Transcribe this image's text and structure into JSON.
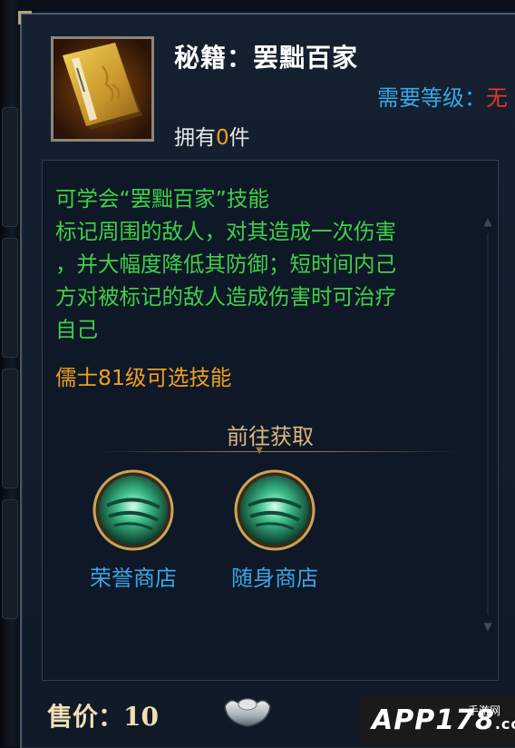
{
  "item": {
    "title": "秘籍：罢黜百家",
    "level_label": "需要等级：",
    "level_value": "无",
    "owned_prefix": "拥有",
    "owned_count": "0",
    "owned_suffix": "件"
  },
  "description": {
    "lines": [
      "可学会“罢黜百家”技能",
      "标记周围的敌人，对其造成一次伤害",
      "，并大幅度降低其防御；短时间内己",
      "方对被标记的敌人造成伤害时可治疗",
      "自己"
    ],
    "class_note": "儒士81级可选技能"
  },
  "goto": {
    "title": "前往获取",
    "shops": [
      {
        "label": "荣誉商店",
        "icon": "green-vortex-icon"
      },
      {
        "label": "随身商店",
        "icon": "green-vortex-icon"
      }
    ]
  },
  "price": {
    "label": "售价：",
    "value": "10",
    "currency_icon": "silver-ingot-icon"
  },
  "watermark": {
    "text": "APP178",
    "sub": "手游网",
    "domain": ".com"
  },
  "colors": {
    "title": "#ffffff",
    "level_label": "#3aa6e6",
    "level_value": "#e03a2a",
    "description": "#3fd04a",
    "class_note": "#f0a020",
    "shop_label": "#3aa6e6",
    "price": "#f2dfb4"
  }
}
